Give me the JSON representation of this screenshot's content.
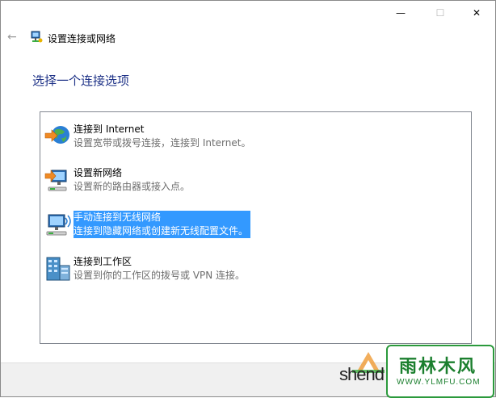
{
  "window": {
    "title": "设置连接或网络",
    "controls": {
      "minimize": "—",
      "maximize": "☐",
      "close": "✕"
    }
  },
  "nav": {
    "back": "←"
  },
  "heading": "选择一个连接选项",
  "options": [
    {
      "title": "连接到 Internet",
      "desc": "设置宽带或拨号连接，连接到 Internet。",
      "icon": "internet-globe-icon",
      "selected": false
    },
    {
      "title": "设置新网络",
      "desc": "设置新的路由器或接入点。",
      "icon": "new-network-icon",
      "selected": false
    },
    {
      "title": "手动连接到无线网络",
      "desc": "连接到隐藏网络或创建新无线配置文件。",
      "icon": "wireless-network-icon",
      "selected": true
    },
    {
      "title": "连接到工作区",
      "desc": "设置到你的工作区的拨号或 VPN 连接。",
      "icon": "workplace-icon",
      "selected": false
    }
  ],
  "watermark": {
    "left_text": "shend",
    "brand": "雨林木风",
    "url": "WWW.YLMFU.COM"
  },
  "colors": {
    "heading": "#1e3287",
    "selection": "#3399ff",
    "watermark_green": "#1b7f2e"
  }
}
